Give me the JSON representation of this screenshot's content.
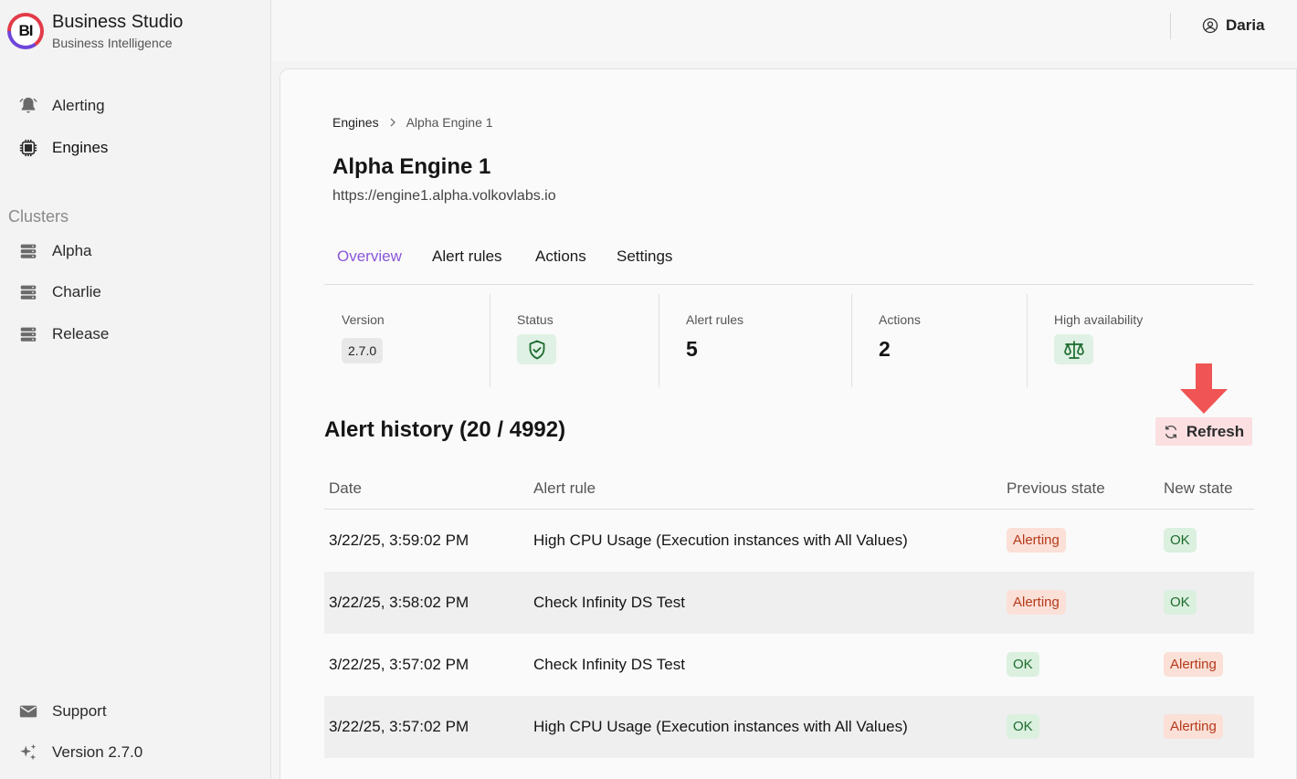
{
  "brand": {
    "logo_text": "BI",
    "title": "Business Studio",
    "subtitle": "Business Intelligence"
  },
  "sidebar": {
    "nav": [
      {
        "label": "Alerting",
        "icon": "bell-icon"
      },
      {
        "label": "Engines",
        "icon": "chip-icon"
      }
    ],
    "clusters_label": "Clusters",
    "clusters": [
      {
        "label": "Alpha",
        "icon": "server-icon"
      },
      {
        "label": "Charlie",
        "icon": "server-icon"
      },
      {
        "label": "Release",
        "icon": "server-icon"
      }
    ],
    "footer": [
      {
        "label": "Support",
        "icon": "envelope-icon"
      },
      {
        "label": "Version 2.7.0",
        "icon": "sparkles-icon"
      }
    ]
  },
  "header": {
    "user": "Daria"
  },
  "breadcrumb": {
    "parent": "Engines",
    "current": "Alpha Engine 1"
  },
  "engine": {
    "name": "Alpha Engine 1",
    "url": "https://engine1.alpha.volkovlabs.io"
  },
  "tabs": [
    "Overview",
    "Alert rules",
    "Actions",
    "Settings"
  ],
  "active_tab": "Overview",
  "stats": {
    "version": {
      "label": "Version",
      "value": "2.7.0"
    },
    "status": {
      "label": "Status",
      "icon": "shield-check-icon"
    },
    "alert_rules": {
      "label": "Alert rules",
      "value": "5"
    },
    "actions": {
      "label": "Actions",
      "value": "2"
    },
    "high_availability": {
      "label": "High availability",
      "icon": "scale-icon"
    }
  },
  "history": {
    "title": "Alert history (20 / 4992)",
    "refresh_label": "Refresh",
    "columns": [
      "Date",
      "Alert rule",
      "Previous state",
      "New state"
    ],
    "rows": [
      {
        "date": "3/22/25, 3:59:02 PM",
        "rule": "High CPU Usage (Execution instances with All Values)",
        "prev": "Alerting",
        "next": "OK"
      },
      {
        "date": "3/22/25, 3:58:02 PM",
        "rule": "Check Infinity DS Test",
        "prev": "Alerting",
        "next": "OK"
      },
      {
        "date": "3/22/25, 3:57:02 PM",
        "rule": "Check Infinity DS Test",
        "prev": "OK",
        "next": "Alerting"
      },
      {
        "date": "3/22/25, 3:57:02 PM",
        "rule": "High CPU Usage (Execution instances with All Values)",
        "prev": "OK",
        "next": "Alerting"
      }
    ]
  },
  "colors": {
    "accent": "#8a57d9",
    "alerting_bg": "#fbe0d7",
    "alerting_text": "#b53a1b",
    "ok_bg": "#dbf0df",
    "ok_text": "#1d6b2e",
    "arrow": "#f05454"
  }
}
